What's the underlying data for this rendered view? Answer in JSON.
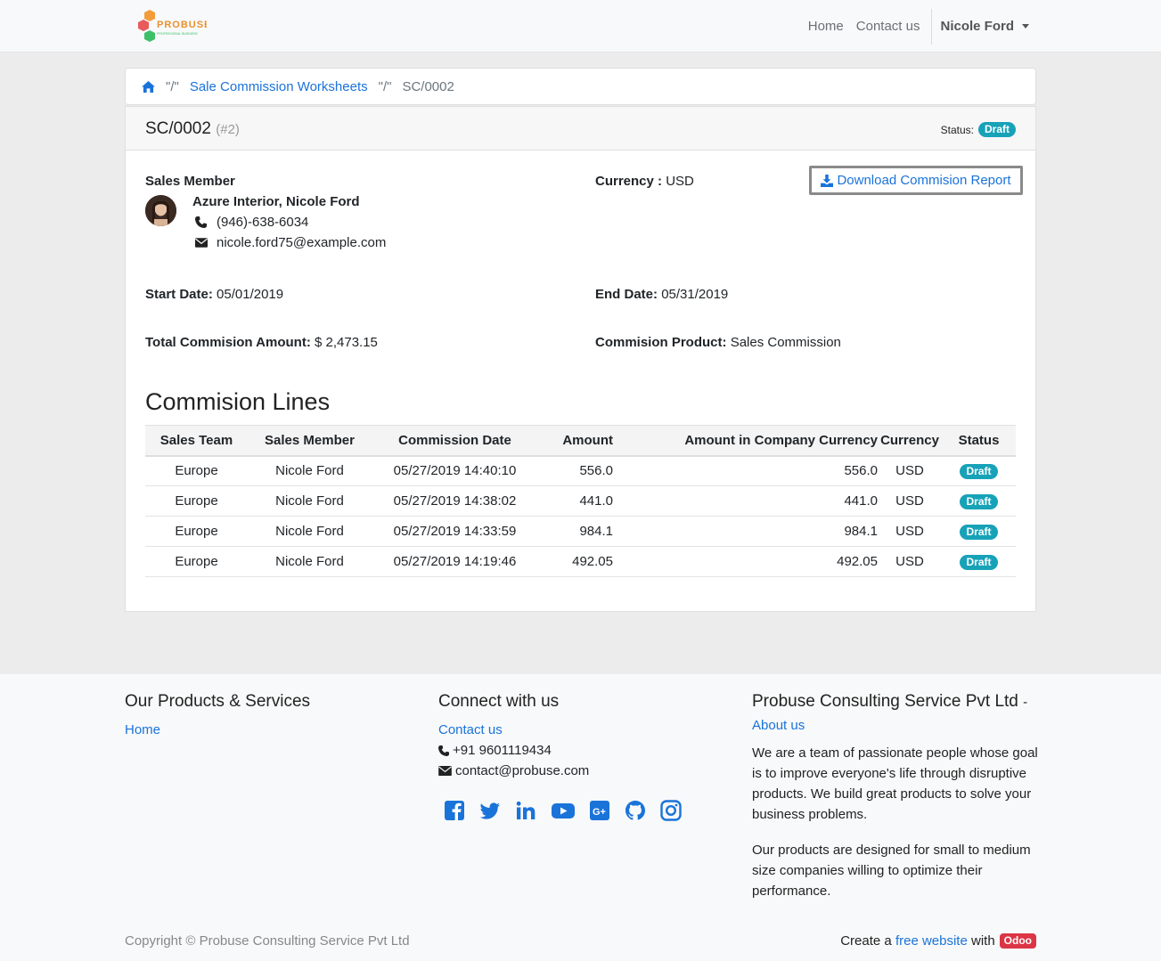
{
  "navbar": {
    "brand": "PROBUSE",
    "brand_tagline": "PROFESSIONAL BUSINESS",
    "links": [
      "Home",
      "Contact us"
    ],
    "user": "Nicole Ford"
  },
  "breadcrumb": {
    "separator": "\"/\"",
    "worksheets": "Sale Commission Worksheets",
    "current": "SC/0002"
  },
  "doc": {
    "title": "SC/0002",
    "id": "(#2)",
    "status_label": "Status:",
    "status": "Draft",
    "download_label": "Download Commision Report",
    "sales_member_label": "Sales Member",
    "member_name": "Azure Interior, Nicole Ford",
    "phone": "(946)-638-6034",
    "email": "nicole.ford75@example.com",
    "currency_label": "Currency :",
    "currency": "USD",
    "start_label": "Start Date:",
    "start": "05/01/2019",
    "end_label": "End Date:",
    "end": "05/31/2019",
    "total_label": "Total Commision Amount:",
    "total": "$ 2,473.15",
    "product_label": "Commision Product:",
    "product": "Sales Commission"
  },
  "lines": {
    "title": "Commision Lines",
    "headers": [
      "Sales Team",
      "Sales Member",
      "Commission Date",
      "Amount",
      "Amount in Company Currency",
      "Currency",
      "Status"
    ],
    "rows": [
      [
        "Europe",
        "Nicole Ford",
        "05/27/2019 14:40:10",
        "556.0",
        "556.0",
        "USD",
        "Draft"
      ],
      [
        "Europe",
        "Nicole Ford",
        "05/27/2019 14:38:02",
        "441.0",
        "441.0",
        "USD",
        "Draft"
      ],
      [
        "Europe",
        "Nicole Ford",
        "05/27/2019 14:33:59",
        "984.1",
        "984.1",
        "USD",
        "Draft"
      ],
      [
        "Europe",
        "Nicole Ford",
        "05/27/2019 14:19:46",
        "492.05",
        "492.05",
        "USD",
        "Draft"
      ]
    ]
  },
  "footer": {
    "products_title": "Our Products & Services",
    "products_home": "Home",
    "connect_title": "Connect with us",
    "contact_link": "Contact us",
    "phone": "+91 9601119434",
    "email": "contact@probuse.com",
    "social_icons": [
      "facebook-icon",
      "twitter-icon",
      "linkedin-icon",
      "youtube-icon",
      "google-plus-icon",
      "github-icon",
      "instagram-icon"
    ],
    "company_title": "Probuse Consulting Service Pvt Ltd",
    "company_dash": "-",
    "about_link": "About us",
    "para1": "We are a team of passionate people whose goal is to improve everyone's life through disruptive products. We build great products to solve your business problems.",
    "para2": "Our products are designed for small to medium size companies willing to optimize their performance.",
    "copyright": "Copyright © Probuse Consulting Service Pvt Ltd",
    "create_text": "Create a",
    "free_website": "free website",
    "with_text": "with",
    "odoo": "Odoo"
  },
  "colors": {
    "link": "#1a73d9",
    "badge_draft": "#17a2b8",
    "odoo_badge": "#dc3545"
  }
}
